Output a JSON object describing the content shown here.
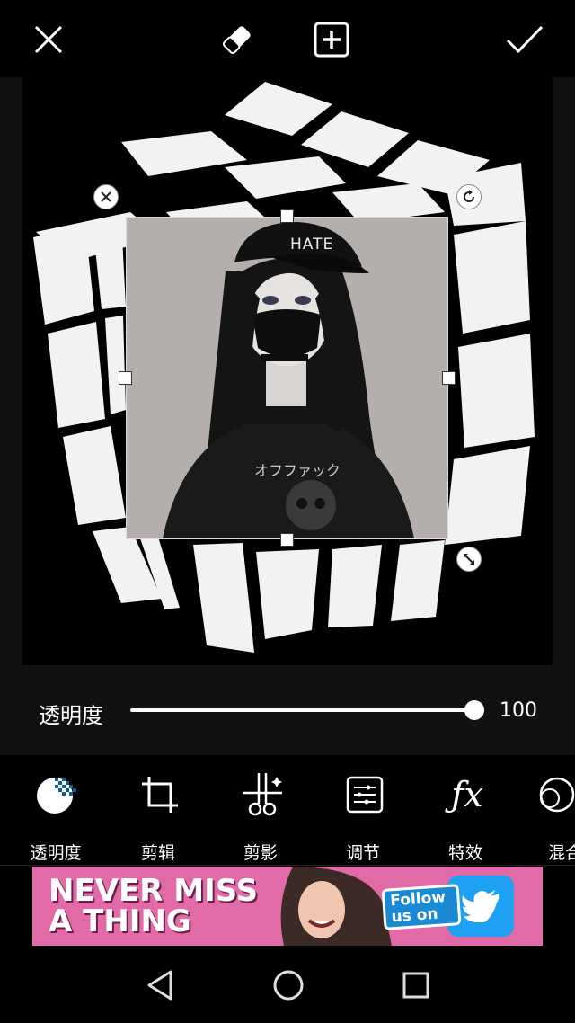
{
  "toolbar": {
    "close_icon": "close-icon",
    "eraser_icon": "eraser-icon",
    "add_icon": "add-layer-icon",
    "apply_icon": "checkmark-icon"
  },
  "editor": {
    "overlay_text_cap": "HATE",
    "overlay_text_shirt": "オフファック"
  },
  "opacity": {
    "label": "透明度",
    "value": "100",
    "fraction": 1.0
  },
  "tools": [
    {
      "label": "透明度",
      "icon": "opacity-icon",
      "active": true
    },
    {
      "label": "剪辑",
      "icon": "crop-icon",
      "active": false
    },
    {
      "label": "剪影",
      "icon": "cutout-icon",
      "active": false
    },
    {
      "label": "调节",
      "icon": "adjust-icon",
      "active": false
    },
    {
      "label": "特效",
      "icon": "fx-icon",
      "active": false
    },
    {
      "label": "混合",
      "icon": "blend-icon",
      "active": false
    }
  ],
  "ad": {
    "headline": "NEVER MISS\nA THING",
    "follow": "Follow\nus on"
  },
  "colors": {
    "active_tool_bg": "#0d5c92",
    "ad_bg": "#e26aa6",
    "twitter_blue": "#1da1f2"
  }
}
